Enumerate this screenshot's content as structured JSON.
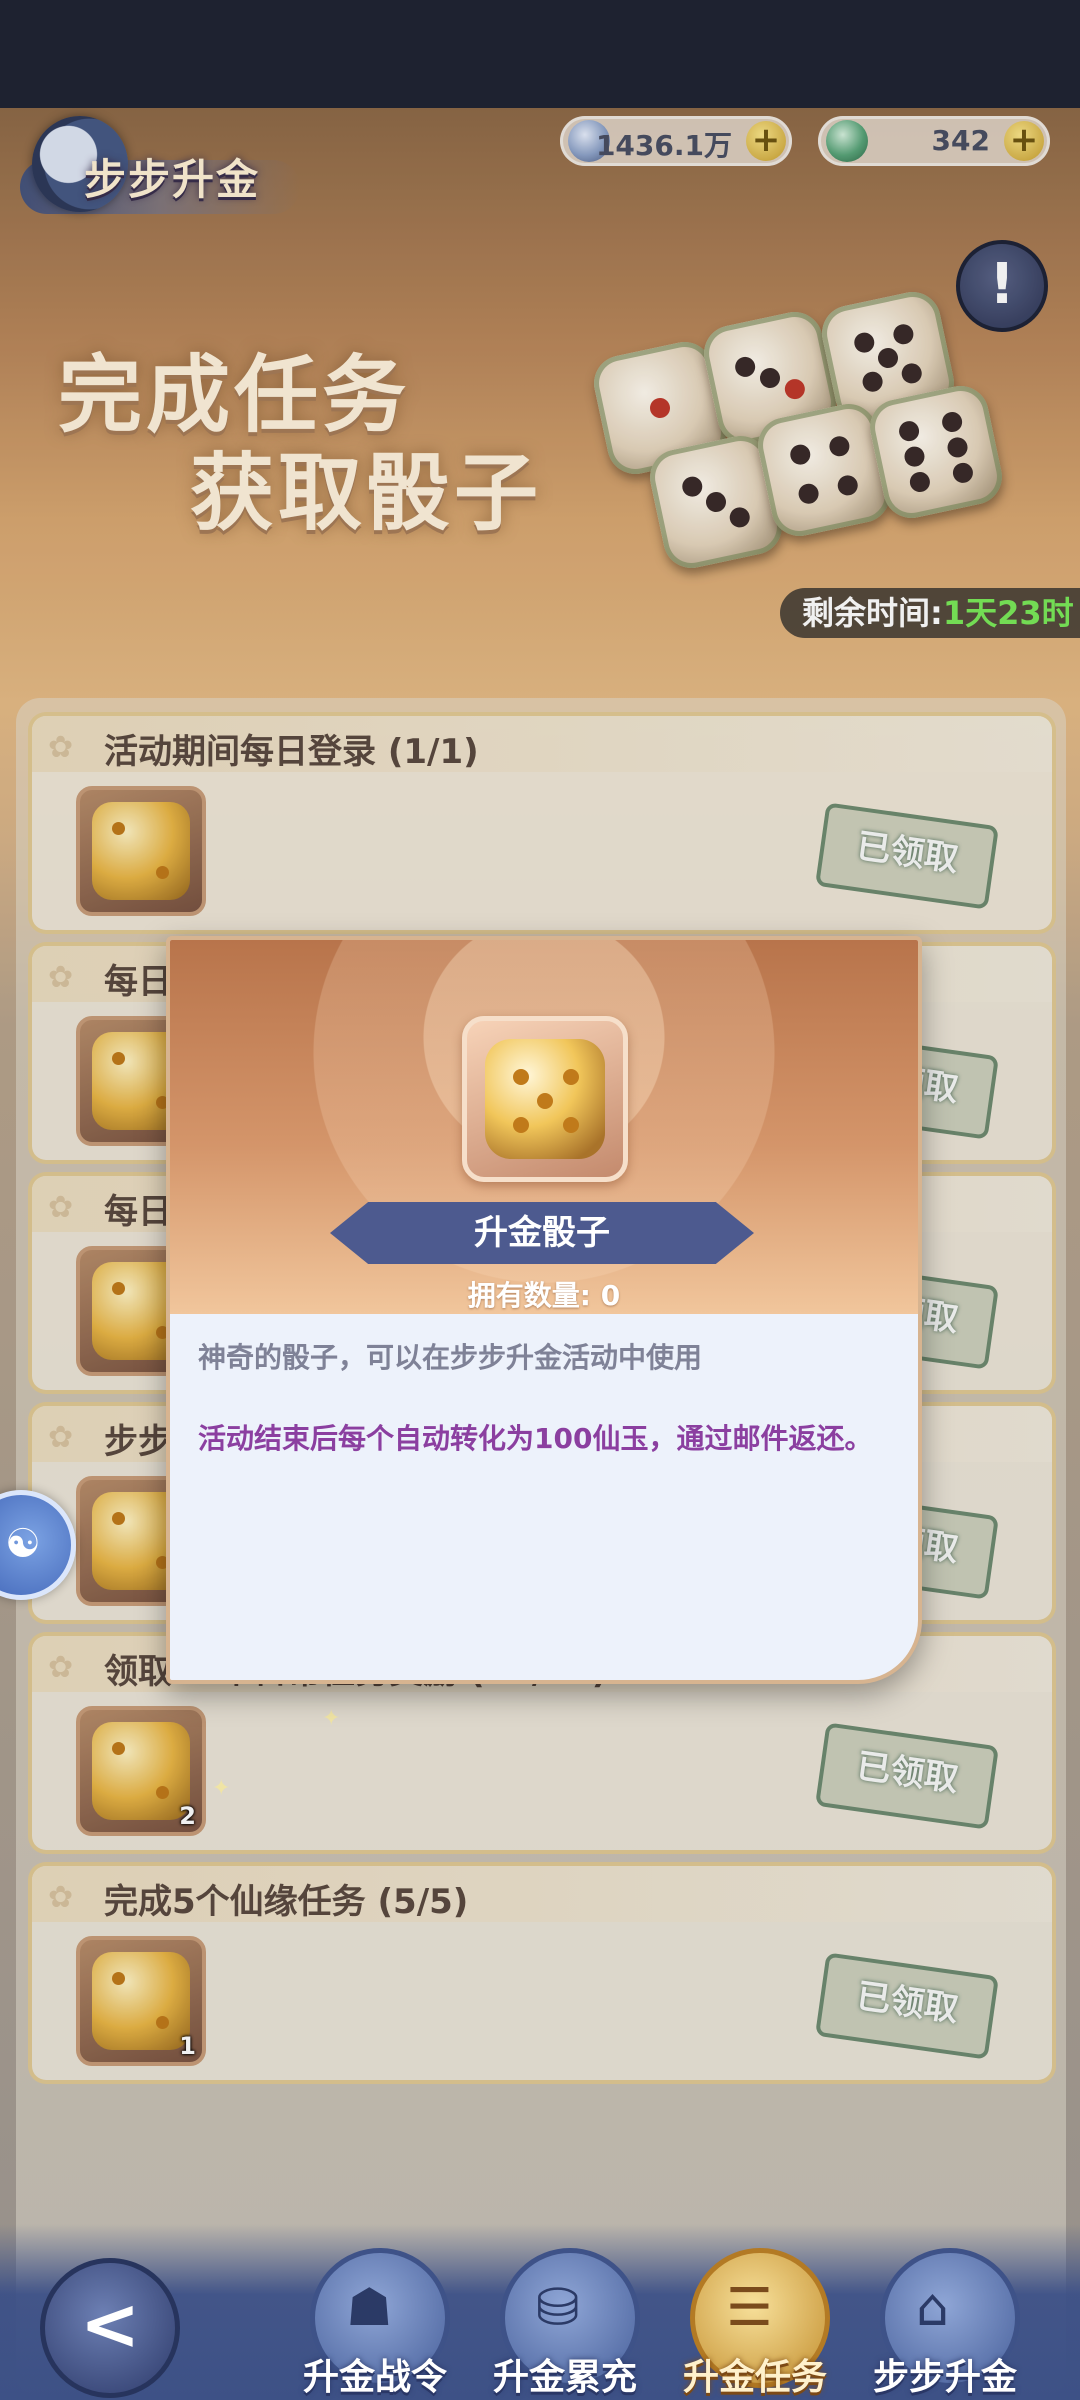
{
  "header": {
    "title": "步步升金",
    "resources": [
      {
        "name": "crystal",
        "value": "1436.1万",
        "icon": "crystal-icon"
      },
      {
        "name": "jade",
        "value": "342",
        "icon": "jade-dragon-icon"
      }
    ],
    "info_symbol": "!"
  },
  "hero": {
    "line1": "完成任务",
    "line2": "获取骰子",
    "timer_label": "剩余时间:",
    "timer_value": "1天23时"
  },
  "tasks": [
    {
      "title": "活动期间每日登录 (1/1)",
      "count": "",
      "status": "已领取"
    },
    {
      "title": "每日",
      "count": "",
      "status": "已领取"
    },
    {
      "title": "每日",
      "count": "",
      "status": "已领取"
    },
    {
      "title": "步步",
      "count": "2",
      "status": "已领取"
    },
    {
      "title": "领取10个日常任务奖励 (10/10)",
      "count": "2",
      "status": "已领取"
    },
    {
      "title": "完成5个仙缘任务 (5/5)",
      "count": "1",
      "status": "已领取"
    }
  ],
  "modal": {
    "item_name": "升金骰子",
    "owned_text": "拥有数量: 0",
    "description": "神奇的骰子，可以在步步升金活动中使用",
    "note": "活动结束后每个自动转化为100仙玉，通过邮件返还。"
  },
  "bottom_nav": {
    "back_symbol": "<",
    "items": [
      {
        "label": "升金战令",
        "icon": "demon-mask-icon",
        "active": false
      },
      {
        "label": "升金累充",
        "icon": "treasure-bowl-icon",
        "active": false
      },
      {
        "label": "升金任务",
        "icon": "scroll-icon",
        "active": true
      },
      {
        "label": "步步升金",
        "icon": "pavilion-icon",
        "active": false
      }
    ]
  },
  "colors": {
    "accent": "#4d5a8f",
    "note": "#8b3fa0",
    "timer": "#7bea5a"
  }
}
